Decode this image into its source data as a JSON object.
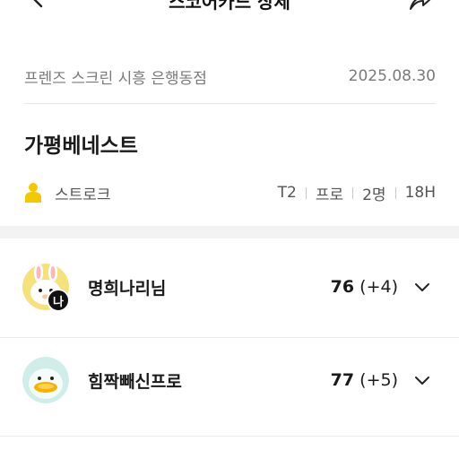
{
  "header": {
    "title": "스코어카드 상세",
    "back_icon": "chevron-left-icon",
    "share_icon": "share-icon"
  },
  "info": {
    "venue": "프렌즈 스크린 시흥 은행동점",
    "date": "2025.08.30"
  },
  "course": {
    "name": "가평베네스트"
  },
  "mode": {
    "icon": "person-icon",
    "label": "스트로크",
    "tee": "T2",
    "level": "프로",
    "players": "2명",
    "holes": "18H"
  },
  "players": [
    {
      "name": "명희나리님",
      "score": "76",
      "diff": "(+4)",
      "me_badge": "나",
      "avatar": "rabbit-character-avatar"
    },
    {
      "name": "힘짝빼신프로",
      "score": "77",
      "diff": "(+5)",
      "avatar": "duck-character-avatar"
    }
  ],
  "colors": {
    "accent_yellow": "#f2c800",
    "divider": "#ececec",
    "band": "#f3f3f3"
  }
}
